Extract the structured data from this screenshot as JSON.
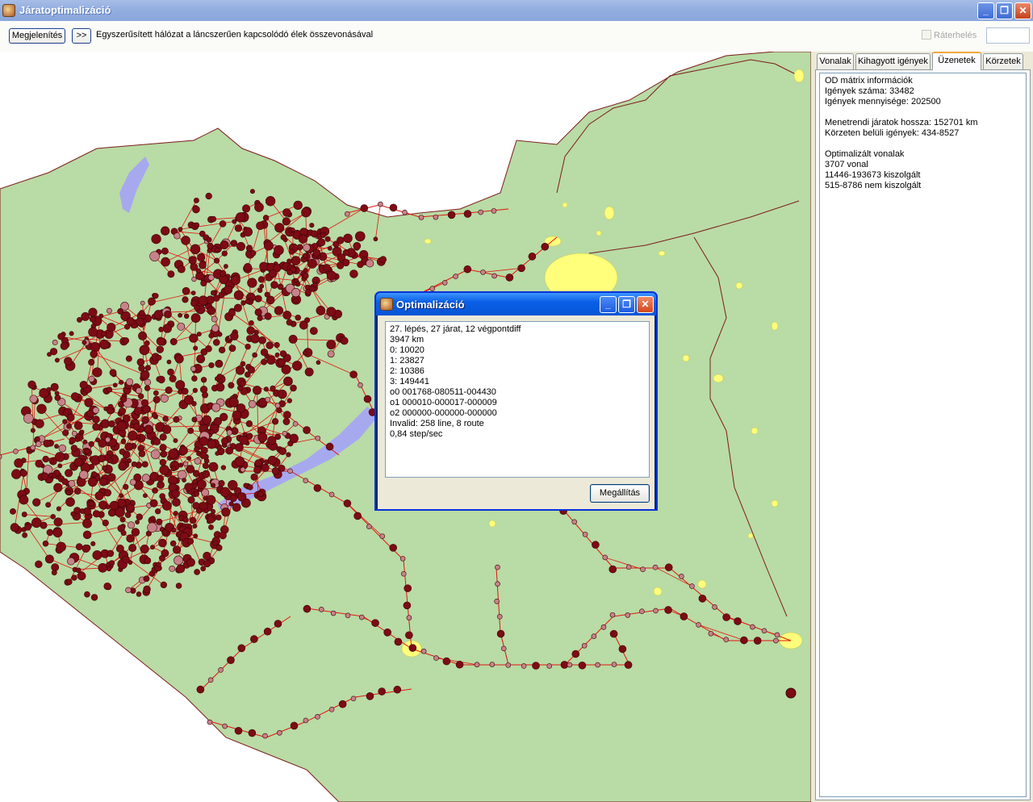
{
  "window": {
    "title": "Járatoptimalizáció",
    "buttons": {
      "minimize": "_",
      "maximize": "❐",
      "close": "✕"
    }
  },
  "toolbar": {
    "show_label": "Megjelenítés",
    "next_label": ">>",
    "description": "Egyszerűsített hálózat a láncszerűen kapcsolódó élek összevonásával",
    "overload_label": "Ráterhelés",
    "overload_checked": false,
    "field_value": ""
  },
  "tabs": [
    {
      "label": "Vonalak",
      "active": false
    },
    {
      "label": "Kihagyott igények",
      "active": false
    },
    {
      "label": "Üzenetek",
      "active": true
    },
    {
      "label": "Körzetek",
      "active": false
    }
  ],
  "messages": [
    "OD mátrix információk",
    "Igények száma: 33482",
    "Igények mennyisége: 202500",
    "",
    "Menetrendi járatok hossza: 152701 km",
    "Körzeten belüli igények: 434-8527",
    "",
    "Optimalizált vonalak",
    "3707 vonal",
    "11446-193673 kiszolgált",
    "515-8786 nem kiszolgált"
  ],
  "dialog": {
    "title": "Optimalizáció",
    "lines": [
      "27. lépés, 27 járat, 12 végpontdiff",
      "3947 km",
      "0: 10020",
      "1: 23827",
      "2: 10386",
      "3: 149441",
      "o0 001768-080511-004430",
      "o1 000010-000017-000009",
      "o2 000000-000000-000000",
      "Invalid: 258 line, 8 route",
      "0,84 step/sec"
    ],
    "stop_label": "Megállítás"
  },
  "map": {
    "colors": {
      "land": "#b9dba5",
      "water": "#a7a9ef",
      "settlement": "#ffff7b",
      "route": "#e0160e",
      "node": "#7c0b14",
      "node_light": "#c78289",
      "border": "#7b1c1c"
    }
  }
}
